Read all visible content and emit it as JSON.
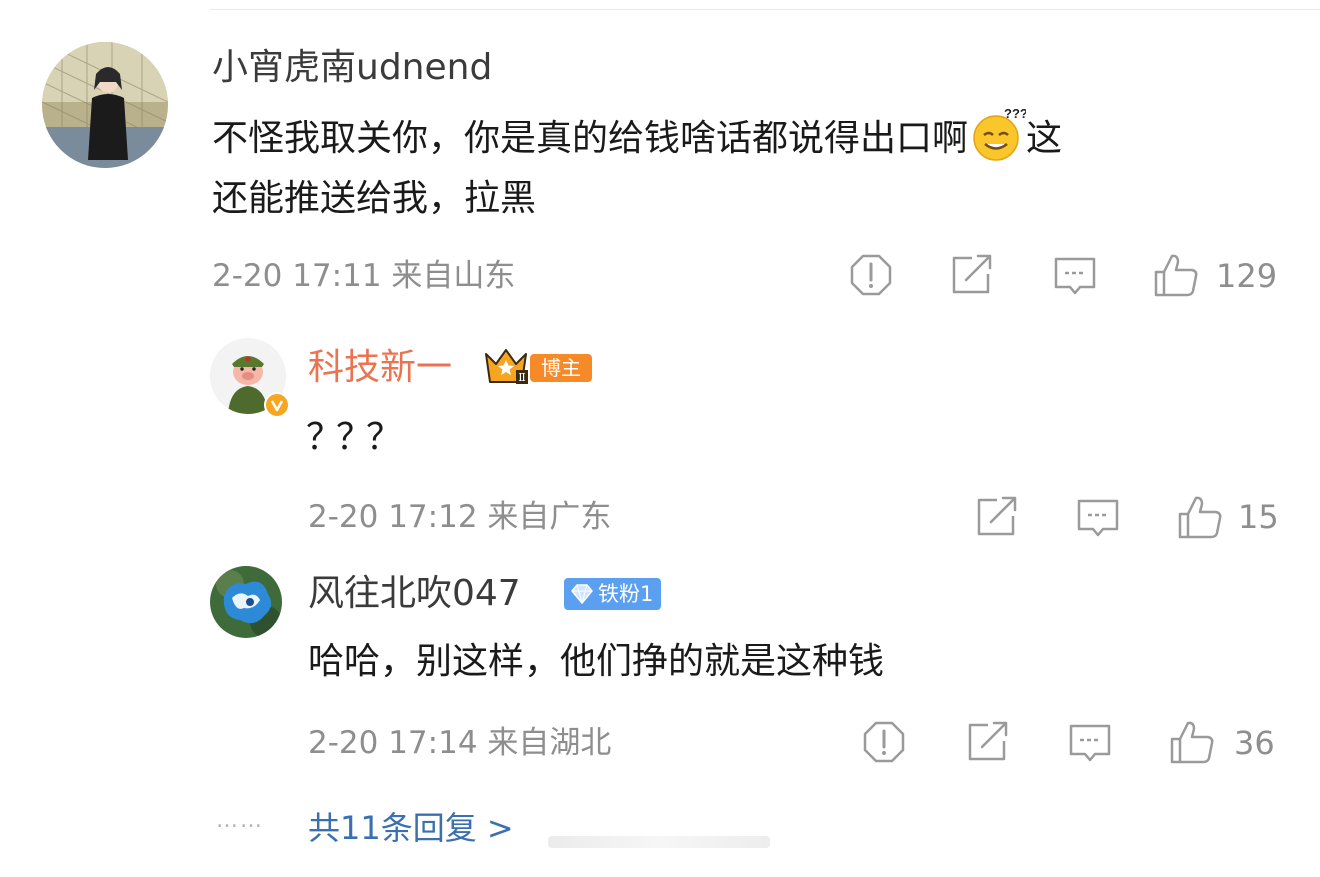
{
  "comment": {
    "username": "小宵虎南udnend",
    "text_part1": "不怪我取关你，你是真的给钱啥话都说得出口啊",
    "emoji": "dizzy-face-emoji",
    "text_part2": "这",
    "text_line2": "还能推送给我，拉黑",
    "meta": "2-20 17:11 来自山东",
    "likes": "129"
  },
  "replies": [
    {
      "username": "科技新一",
      "badge_level": "Ⅱ",
      "badge_label": "博主",
      "verified": true,
      "text": "？？？",
      "meta": "2-20 17:12 来自广东",
      "likes": "15"
    },
    {
      "username": "风往北吹047",
      "badge_label": "铁粉1",
      "text": "哈哈，别这样，他们挣的就是这种钱",
      "meta": "2-20 17:14 来自湖北",
      "likes": "36"
    }
  ],
  "footer": {
    "dots": "……",
    "more_replies": "共11条回复 >"
  },
  "colors": {
    "blogger_name": "#eb7350",
    "more_link": "#3a6fb0",
    "meta_gray": "#8e8e8e",
    "icon_gray": "#9a9a9a",
    "badge_orange": "#f78a28"
  }
}
